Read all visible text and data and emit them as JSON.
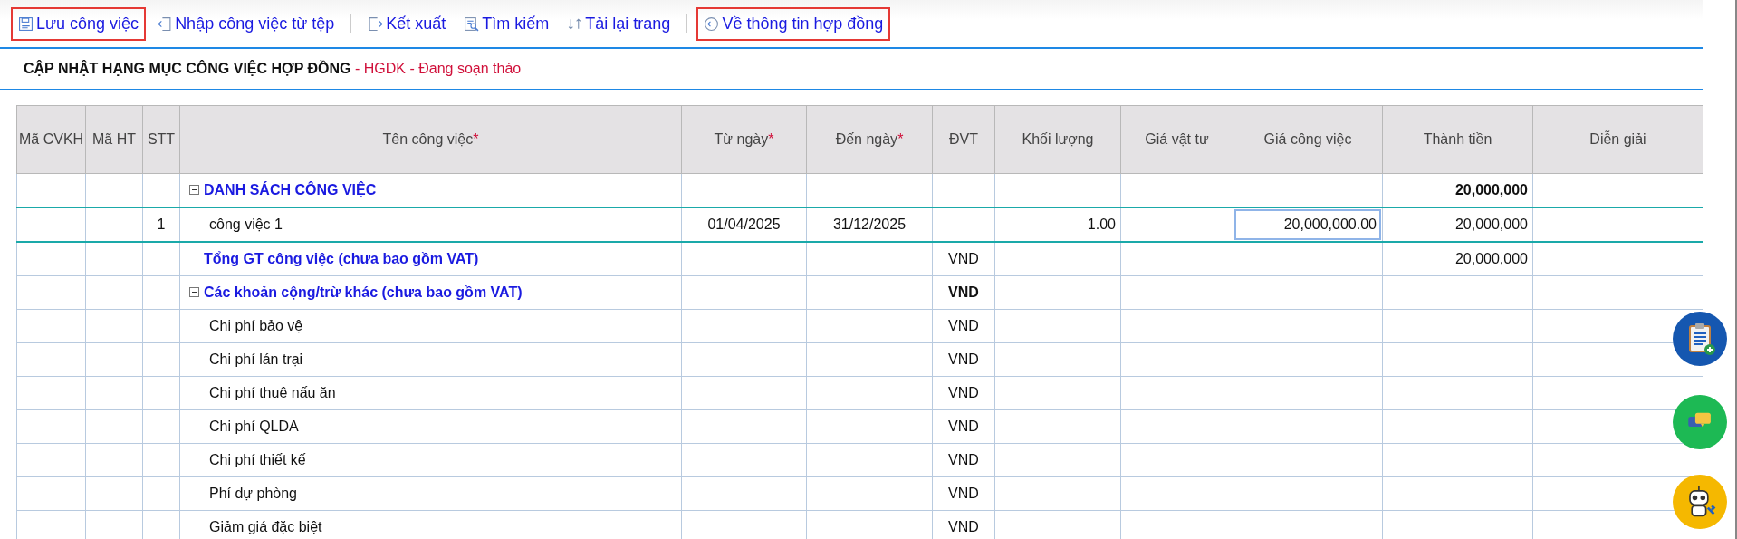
{
  "toolbar": [
    {
      "buttons": [
        {
          "kind": "save",
          "label": "Lưu công việc",
          "highlighted": true
        },
        {
          "kind": "import",
          "label": "Nhập công việc từ tệp",
          "highlighted": false
        }
      ]
    },
    {
      "buttons": [
        {
          "kind": "export",
          "label": "Kết xuất",
          "highlighted": false
        },
        {
          "kind": "search",
          "label": "Tìm kiếm",
          "highlighted": false
        },
        {
          "kind": "reload",
          "label": "Tải lại trang",
          "highlighted": false
        }
      ]
    },
    {
      "buttons": [
        {
          "kind": "back",
          "label": "Về thông tin hợp đồng",
          "highlighted": true
        }
      ]
    }
  ],
  "title": {
    "main": "CẬP NHẬT HẠNG MỤC CÔNG VIỆC HỢP ĐỒNG",
    "sub": " - HGDK - Đang soạn thảo"
  },
  "table": {
    "columns": [
      {
        "label": "Mã CVKH",
        "editable": false
      },
      {
        "label": "Mã HT",
        "editable": false
      },
      {
        "label": "STT",
        "editable": false
      },
      {
        "label": "Tên công việc",
        "required_mark": "*",
        "editable": false
      },
      {
        "label": "Từ ngày",
        "required_mark": "*",
        "editable": false
      },
      {
        "label": "Đến ngày",
        "required_mark": "*",
        "editable": false
      },
      {
        "label": "ĐVT",
        "editable": false
      },
      {
        "label": "Khối lượng",
        "editable": false
      },
      {
        "label": "Giá vật tư",
        "editable": false
      },
      {
        "label": "Giá công việc",
        "editable": true
      },
      {
        "label": "Thành tiền",
        "editable": false
      },
      {
        "label": "Diễn giải",
        "editable": false
      }
    ],
    "rows": [
      {
        "kind": "group",
        "selected": false,
        "expanded": true,
        "ten": "DANH SÁCH CÔNG VIỆC",
        "thanh_tien": "20,000,000"
      },
      {
        "kind": "item",
        "selected": true,
        "stt": "1",
        "ten": "công việc 1",
        "tu_ngay": "01/04/2025",
        "den_ngay": "31/12/2025",
        "khoi_luong": "1.00",
        "gia_cong_viec": "20,000,000.00",
        "thanh_tien": "20,000,000"
      },
      {
        "kind": "total",
        "selected": false,
        "ten": "Tổng GT công việc (chưa bao gồm VAT)",
        "dvt": "VND",
        "thanh_tien": "20,000,000"
      },
      {
        "kind": "group",
        "selected": false,
        "expanded": true,
        "ten": "Các khoản cộng/trừ khác (chưa bao gồm VAT)",
        "dvt": "VND"
      },
      {
        "kind": "item",
        "selected": false,
        "ten": "Chi phí bảo vệ",
        "dvt": "VND"
      },
      {
        "kind": "item",
        "selected": false,
        "ten": "Chi phí lán trại",
        "dvt": "VND"
      },
      {
        "kind": "item",
        "selected": false,
        "ten": "Chi phí thuê nấu ăn",
        "dvt": "VND"
      },
      {
        "kind": "item",
        "selected": false,
        "ten": "Chi phí QLDA",
        "dvt": "VND"
      },
      {
        "kind": "item",
        "selected": false,
        "ten": "Chi phí thiết kế",
        "dvt": "VND"
      },
      {
        "kind": "item",
        "selected": false,
        "ten": "Phí dự phòng",
        "dvt": "VND"
      },
      {
        "kind": "item",
        "selected": false,
        "ten": "Giảm giá đặc biệt",
        "dvt": "VND"
      }
    ]
  }
}
